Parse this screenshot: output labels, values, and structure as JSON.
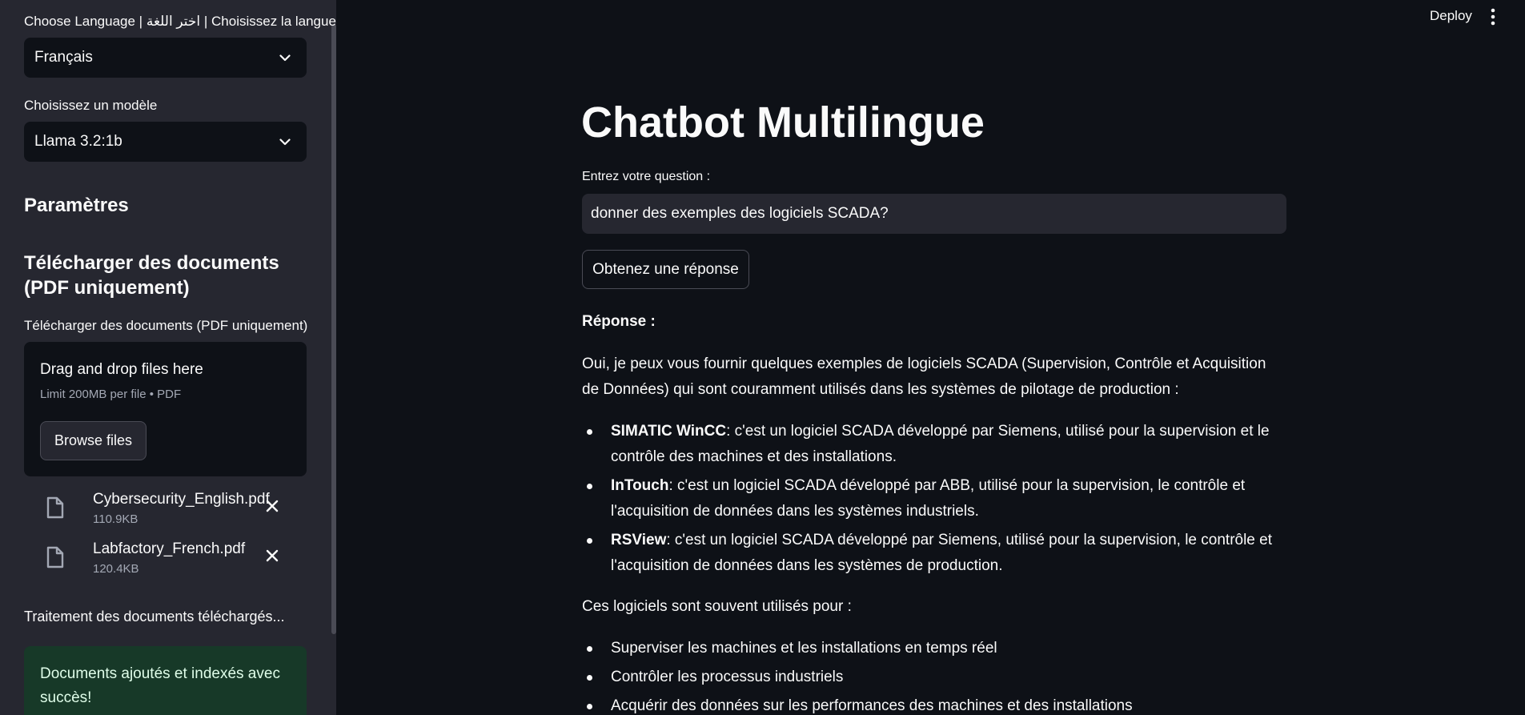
{
  "sidebar": {
    "language_label": "Choose Language | اختر اللغة | Choisissez la langue",
    "language_value": "Français",
    "model_label": "Choisissez un modèle",
    "model_value": "Llama 3.2:1b",
    "params_heading": "Paramètres",
    "upload_heading": "Télécharger des documents (PDF uniquement)",
    "upload_label": "Télécharger des documents (PDF uniquement)",
    "dropzone_title": "Drag and drop files here",
    "dropzone_limit": "Limit 200MB per file • PDF",
    "browse_label": "Browse files",
    "files": [
      {
        "name": "Cybersecurity_English.pdf",
        "size": "110.9KB"
      },
      {
        "name": "Labfactory_French.pdf",
        "size": "120.4KB"
      }
    ],
    "processing_text": "Traitement des documents téléchargés...",
    "success_text": "Documents ajoutés et indexés avec succès!"
  },
  "header": {
    "deploy_label": "Deploy"
  },
  "main": {
    "title": "Chatbot Multilingue",
    "question_label": "Entrez votre question :",
    "question_value": "donner des exemples des logiciels SCADA?",
    "ask_button": "Obtenez une réponse",
    "response_label": "Réponse :",
    "intro": "Oui, je peux vous fournir quelques exemples de logiciels SCADA (Supervision, Contrôle et Acquisition de Données) qui sont couramment utilisés dans les systèmes de pilotage de production :",
    "examples": [
      {
        "name": "SIMATIC WinCC",
        "desc": ": c'est un logiciel SCADA développé par Siemens, utilisé pour la supervision et le contrôle des machines et des installations."
      },
      {
        "name": "InTouch",
        "desc": ": c'est un logiciel SCADA développé par ABB, utilisé pour la supervision, le contrôle et l'acquisition de données dans les systèmes industriels."
      },
      {
        "name": "RSView",
        "desc": ": c'est un logiciel SCADA développé par Siemens, utilisé pour la supervision, le contrôle et l'acquisition de données dans les systèmes de production."
      }
    ],
    "usage_intro": "Ces logiciels sont souvent utilisés pour :",
    "usages": [
      "Superviser les machines et les installations en temps réel",
      "Contrôler les processus industriels",
      "Acquérir des données sur les performances des machines et des installations"
    ]
  },
  "colors": {
    "background": "#0e1117",
    "sidebar": "#262730",
    "success_bg": "#173928",
    "success_text": "#dffde9"
  }
}
